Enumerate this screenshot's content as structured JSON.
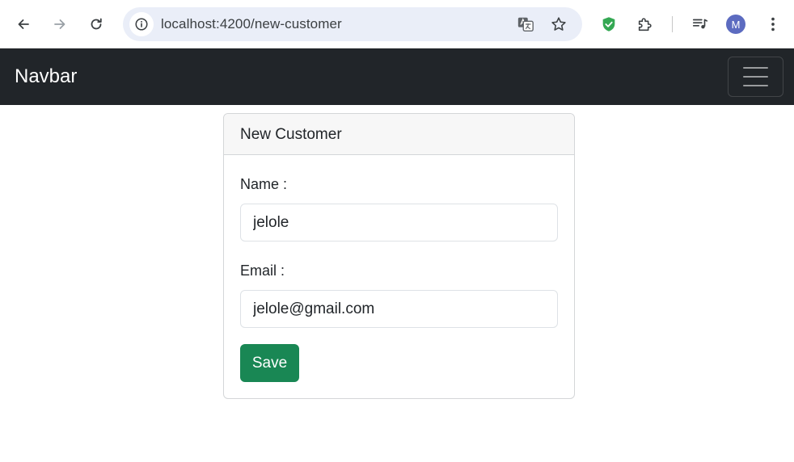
{
  "browser": {
    "url": "localhost:4200/new-customer",
    "avatar_initial": "M",
    "icons": {
      "back": "arrow-left-icon",
      "forward": "arrow-right-icon",
      "reload": "reload-icon",
      "site_info": "info-icon",
      "translate": "translate-icon",
      "bookmark": "star-icon",
      "extension_shield": "shield-check-icon",
      "extensions": "puzzle-icon",
      "media": "media-queue-icon",
      "menu": "kebab-menu-icon"
    },
    "colors": {
      "omnibox_bg": "#eaeef8",
      "shield_green": "#34a853",
      "avatar_bg": "#5c6bc0"
    }
  },
  "navbar": {
    "brand": "Navbar",
    "toggler_icon": "hamburger-icon",
    "bg_color": "#212529"
  },
  "card": {
    "title": "New Customer",
    "form": {
      "name_label": "Name :",
      "name_value": "jelole",
      "email_label": "Email :",
      "email_value": "jelole@gmail.com",
      "save_label": "Save",
      "save_color": "#198754"
    }
  }
}
